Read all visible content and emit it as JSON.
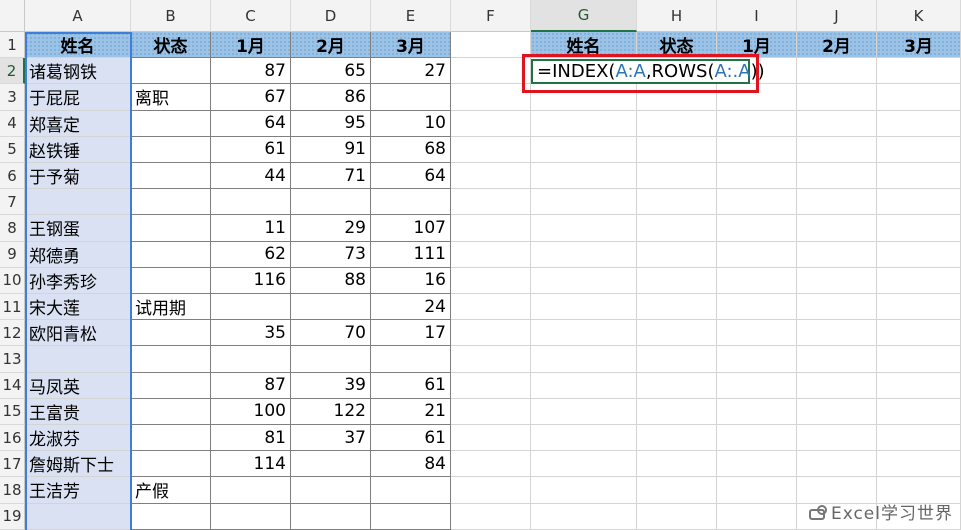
{
  "columns": [
    "A",
    "B",
    "C",
    "D",
    "E",
    "F",
    "G",
    "H",
    "I",
    "J",
    "K"
  ],
  "selected_column": "G",
  "rows": [
    "1",
    "2",
    "3",
    "4",
    "5",
    "6",
    "7",
    "8",
    "9",
    "10",
    "11",
    "12",
    "13",
    "14",
    "15",
    "16",
    "17",
    "18",
    "19"
  ],
  "selected_row": "2",
  "table_headers": [
    "姓名",
    "状态",
    "1月",
    "2月",
    "3月"
  ],
  "output_headers": [
    "姓名",
    "状态",
    "1月",
    "2月",
    "3月"
  ],
  "data_rows": [
    {
      "name": "诸葛钢铁",
      "status": "",
      "m1": "87",
      "m2": "65",
      "m3": "27"
    },
    {
      "name": "于屁屁",
      "status": "离职",
      "m1": "67",
      "m2": "86",
      "m3": ""
    },
    {
      "name": "郑喜定",
      "status": "",
      "m1": "64",
      "m2": "95",
      "m3": "10"
    },
    {
      "name": "赵铁锤",
      "status": "",
      "m1": "61",
      "m2": "91",
      "m3": "68"
    },
    {
      "name": "于予菊",
      "status": "",
      "m1": "44",
      "m2": "71",
      "m3": "64"
    },
    {
      "name": "",
      "status": "",
      "m1": "",
      "m2": "",
      "m3": ""
    },
    {
      "name": "王钢蛋",
      "status": "",
      "m1": "11",
      "m2": "29",
      "m3": "107"
    },
    {
      "name": "郑德勇",
      "status": "",
      "m1": "62",
      "m2": "73",
      "m3": "111"
    },
    {
      "name": "孙李秀珍",
      "status": "",
      "m1": "116",
      "m2": "88",
      "m3": "16"
    },
    {
      "name": "宋大莲",
      "status": "试用期",
      "m1": "",
      "m2": "",
      "m3": "24"
    },
    {
      "name": "欧阳青松",
      "status": "",
      "m1": "35",
      "m2": "70",
      "m3": "17"
    },
    {
      "name": "",
      "status": "",
      "m1": "",
      "m2": "",
      "m3": ""
    },
    {
      "name": "马凤英",
      "status": "",
      "m1": "87",
      "m2": "39",
      "m3": "61"
    },
    {
      "name": "王富贵",
      "status": "",
      "m1": "100",
      "m2": "122",
      "m3": "21"
    },
    {
      "name": "龙淑芬",
      "status": "",
      "m1": "81",
      "m2": "37",
      "m3": "61"
    },
    {
      "name": "詹姆斯下士",
      "status": "",
      "m1": "114",
      "m2": "",
      "m3": "84"
    },
    {
      "name": "王洁芳",
      "status": "产假",
      "m1": "",
      "m2": "",
      "m3": ""
    },
    {
      "name": "",
      "status": "",
      "m1": "",
      "m2": "",
      "m3": ""
    }
  ],
  "formula": {
    "eq": "=INDEX(",
    "ref1": "A:A",
    "mid": ",ROWS(",
    "ref2": "A:.A",
    "end": "))"
  },
  "watermark": "Excel学习世界",
  "colors": {
    "header_fill": "#9cc3e6",
    "column_a_fill": "#d9e1f2",
    "highlight_red": "#e0141e",
    "reference_blue": "#2e75b6",
    "active_green": "#217346"
  }
}
